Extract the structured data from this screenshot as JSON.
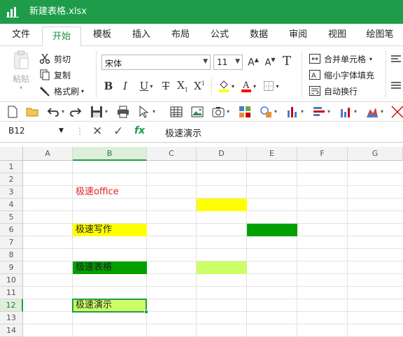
{
  "window": {
    "title": "新建表格.xlsx"
  },
  "tabs": [
    {
      "label": "文件"
    },
    {
      "label": "开始"
    },
    {
      "label": "模板"
    },
    {
      "label": "插入"
    },
    {
      "label": "布局"
    },
    {
      "label": "公式"
    },
    {
      "label": "数据"
    },
    {
      "label": "审阅"
    },
    {
      "label": "视图"
    },
    {
      "label": "绘图笔"
    }
  ],
  "active_tab": "开始",
  "ribbon": {
    "paste_label": "粘贴",
    "cut_label": "剪切",
    "copy_label": "复制",
    "format_painter_label": "格式刷",
    "font_name": "宋体",
    "font_size": "11",
    "merge_label": "合并单元格",
    "shrink_label": "缩小字体填充",
    "wrap_label": "自动换行",
    "highlight_color": "#ffff00",
    "font_color": "#ff0000"
  },
  "formula_bar": {
    "name_box": "B12",
    "fx_label": "fx",
    "content": "极速演示"
  },
  "grid": {
    "columns": [
      "A",
      "B",
      "C",
      "D",
      "E",
      "F",
      "G"
    ],
    "rows": [
      "1",
      "2",
      "3",
      "4",
      "5",
      "6",
      "7",
      "8",
      "9",
      "10",
      "11",
      "12",
      "13",
      "14"
    ],
    "selected_cell": "B12",
    "cells": {
      "B3": {
        "text": "极速office",
        "color": "#e02020"
      },
      "B6": {
        "text": "极速写作",
        "fill": "#ffff00"
      },
      "B9": {
        "text": "极速表格",
        "fill": "#00a000"
      },
      "B12": {
        "text": "极速演示",
        "fill": "#ccff66"
      }
    },
    "fills": {
      "D4": "#ffff00",
      "E6": "#00a000",
      "D9": "#ccff66"
    }
  }
}
